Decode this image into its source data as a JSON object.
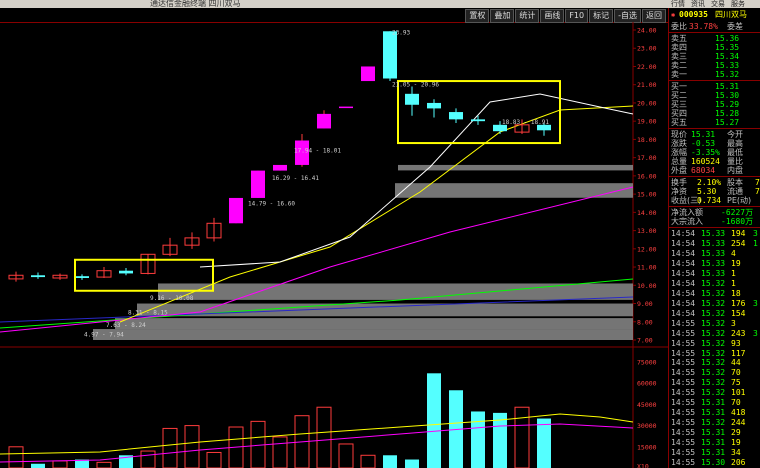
{
  "window": {
    "title": "通达信金融终端 四川双马"
  },
  "toolbar": {
    "buttons": [
      "置权",
      "叠加",
      "统计",
      "画线",
      "F10",
      "标记",
      "-自选",
      "返回"
    ]
  },
  "right_tabs": [
    "行情",
    "资讯",
    "交易",
    "服务"
  ],
  "stock": {
    "code": "000935",
    "name": "四川双马",
    "flag": "✱"
  },
  "ratio": {
    "label1": "委比",
    "value": "33.78%",
    "label2": "委差",
    "diff": ""
  },
  "asks": [
    {
      "label": "卖五",
      "price": "15.36"
    },
    {
      "label": "卖四",
      "price": "15.35"
    },
    {
      "label": "卖三",
      "price": "15.34"
    },
    {
      "label": "卖二",
      "price": "15.33"
    },
    {
      "label": "卖一",
      "price": "15.32"
    }
  ],
  "bids": [
    {
      "label": "买一",
      "price": "15.31"
    },
    {
      "label": "买二",
      "price": "15.30"
    },
    {
      "label": "买三",
      "price": "15.29"
    },
    {
      "label": "买四",
      "price": "15.28"
    },
    {
      "label": "买五",
      "price": "15.27"
    }
  ],
  "quote": [
    {
      "l1": "现价",
      "v1": "15.31",
      "l2": "今开",
      "c1": "#00ff00"
    },
    {
      "l1": "涨跌",
      "v1": "-0.53",
      "l2": "最高",
      "c1": "#00ff00"
    },
    {
      "l1": "涨幅",
      "v1": "-3.35%",
      "l2": "最低",
      "c1": "#00ff00"
    },
    {
      "l1": "总量",
      "v1": "160524",
      "l2": "量比",
      "c1": "#ffff00"
    },
    {
      "l1": "外盘",
      "v1": "68034",
      "l2": "内盘",
      "c1": "#ff4040"
    }
  ],
  "stats": [
    {
      "l1": "换手",
      "v1": "2.10%",
      "l2": "股本",
      "v2": "7"
    },
    {
      "l1": "净资",
      "v1": "5.30",
      "l2": "流通",
      "v2": "7"
    },
    {
      "l1": "收益(三)",
      "v1": "0.734",
      "l2": "PE(动)",
      "v2": ""
    }
  ],
  "flows": [
    {
      "label": "净流入额",
      "value": "-6227万"
    },
    {
      "label": "大宗流入",
      "value": "-1680万"
    }
  ],
  "ticks": [
    {
      "t": "14:54",
      "p": "15.33",
      "v": "194",
      "d": "3"
    },
    {
      "t": "14:54",
      "p": "15.33",
      "v": "254",
      "d": "1"
    },
    {
      "t": "14:54",
      "p": "15.33",
      "v": "4",
      "d": ""
    },
    {
      "t": "14:54",
      "p": "15.33",
      "v": "19",
      "d": ""
    },
    {
      "t": "14:54",
      "p": "15.33",
      "v": "1",
      "d": ""
    },
    {
      "t": "14:54",
      "p": "15.32",
      "v": "1",
      "d": ""
    },
    {
      "t": "14:54",
      "p": "15.32",
      "v": "18",
      "d": ""
    },
    {
      "t": "14:54",
      "p": "15.32",
      "v": "176",
      "d": "3"
    },
    {
      "t": "14:54",
      "p": "15.32",
      "v": "154",
      "d": ""
    },
    {
      "t": "14:55",
      "p": "15.32",
      "v": "3",
      "d": ""
    },
    {
      "t": "14:55",
      "p": "15.32",
      "v": "243",
      "d": "3"
    },
    {
      "t": "14:55",
      "p": "15.32",
      "v": "93",
      "d": ""
    },
    {
      "t": "14:55",
      "p": "15.32",
      "v": "117",
      "d": ""
    },
    {
      "t": "14:55",
      "p": "15.32",
      "v": "44",
      "d": ""
    },
    {
      "t": "14:55",
      "p": "15.32",
      "v": "70",
      "d": ""
    },
    {
      "t": "14:55",
      "p": "15.32",
      "v": "75",
      "d": ""
    },
    {
      "t": "14:55",
      "p": "15.32",
      "v": "101",
      "d": ""
    },
    {
      "t": "14:55",
      "p": "15.31",
      "v": "70",
      "d": ""
    },
    {
      "t": "14:55",
      "p": "15.31",
      "v": "418",
      "d": ""
    },
    {
      "t": "14:55",
      "p": "15.32",
      "v": "244",
      "d": ""
    },
    {
      "t": "14:55",
      "p": "15.31",
      "v": "29",
      "d": ""
    },
    {
      "t": "14:55",
      "p": "15.31",
      "v": "19",
      "d": ""
    },
    {
      "t": "14:55",
      "p": "15.31",
      "v": "34",
      "d": ""
    },
    {
      "t": "14:55",
      "p": "15.30",
      "v": "206",
      "d": ""
    }
  ],
  "chart_data": {
    "type": "candlestick",
    "price_axis": {
      "min": 7,
      "max": 24,
      "labels": [
        "24.00",
        "23.00",
        "22.00",
        "21.00",
        "20.00",
        "19.00",
        "18.00",
        "17.00",
        "16.00",
        "15.00",
        "14.00",
        "13.00",
        "12.00",
        "11.00",
        "10.00",
        "9.00",
        "8.00",
        "7.00"
      ]
    },
    "volume_axis": {
      "max": 75000,
      "labels": [
        "75000",
        "60000",
        "45000",
        "30000",
        "15000",
        "X10"
      ]
    },
    "candles": [
      {
        "o": 10.35,
        "c": 10.55,
        "h": 10.75,
        "l": 10.2
      },
      {
        "o": 10.55,
        "c": 10.45,
        "h": 10.7,
        "l": 10.35
      },
      {
        "o": 10.4,
        "c": 10.55,
        "h": 10.65,
        "l": 10.3
      },
      {
        "o": 10.5,
        "c": 10.4,
        "h": 10.6,
        "l": 10.3
      },
      {
        "o": 10.45,
        "c": 10.8,
        "h": 11.0,
        "l": 10.4
      },
      {
        "o": 10.8,
        "c": 10.65,
        "h": 10.95,
        "l": 10.55
      },
      {
        "o": 10.65,
        "c": 11.7,
        "h": 11.7,
        "l": 10.6
      },
      {
        "o": 11.7,
        "c": 12.2,
        "h": 12.6,
        "l": 11.6
      },
      {
        "o": 12.2,
        "c": 12.6,
        "h": 12.9,
        "l": 12.0
      },
      {
        "o": 12.6,
        "c": 13.4,
        "h": 13.7,
        "l": 12.4
      },
      {
        "o": 13.4,
        "c": 14.79,
        "h": 14.79,
        "l": 13.4
      },
      {
        "o": 14.79,
        "c": 16.29,
        "h": 16.29,
        "l": 14.79
      },
      {
        "o": 16.29,
        "c": 16.6,
        "h": 16.6,
        "l": 16.29
      },
      {
        "o": 16.6,
        "c": 17.94,
        "h": 18.3,
        "l": 16.5
      },
      {
        "o": 18.6,
        "c": 19.4,
        "h": 19.6,
        "l": 18.6
      },
      {
        "o": 19.8,
        "c": 19.8,
        "h": 19.8,
        "l": 19.8
      },
      {
        "o": 21.2,
        "c": 22.0,
        "h": 22.0,
        "l": 21.2
      },
      {
        "o": 23.93,
        "c": 21.34,
        "h": 23.93,
        "l": 21.2
      },
      {
        "o": 20.5,
        "c": 19.9,
        "h": 20.9,
        "l": 19.3
      },
      {
        "o": 20.0,
        "c": 19.7,
        "h": 20.2,
        "l": 19.2
      },
      {
        "o": 19.5,
        "c": 19.1,
        "h": 19.7,
        "l": 18.9
      },
      {
        "o": 19.1,
        "c": 19.0,
        "h": 19.3,
        "l": 18.8
      },
      {
        "o": 18.8,
        "c": 18.45,
        "h": 19.0,
        "l": 18.3
      },
      {
        "o": 18.4,
        "c": 18.8,
        "h": 19.1,
        "l": 18.3
      },
      {
        "o": 18.8,
        "c": 18.5,
        "h": 18.9,
        "l": 18.2
      }
    ],
    "volumes": [
      15000,
      3000,
      5000,
      6000,
      4000,
      9000,
      12000,
      28000,
      30000,
      11000,
      29000,
      33000,
      22000,
      37000,
      43000,
      17000,
      9000,
      9000,
      6000,
      67000,
      55000,
      40000,
      39000,
      43000,
      35000
    ],
    "annotations": [
      "23.93",
      "21.05 - 20.96",
      "18.83 - 18.91",
      "17.94 - 18.01",
      "16.29 - 16.41",
      "14.79 - 16.60",
      "9.16 - 10.08",
      "8.31 - 8.15",
      "7.63 - 8.24",
      "4.97 - 7.94"
    ],
    "support_bands": [
      {
        "from": 16.3,
        "to": 16.6
      },
      {
        "from": 14.8,
        "to": 15.6
      },
      {
        "from": 9.2,
        "to": 10.1
      },
      {
        "from": 8.3,
        "to": 9.0
      },
      {
        "from": 7.6,
        "to": 8.2
      },
      {
        "from": 7.0,
        "to": 7.6
      }
    ],
    "colors": {
      "up": "#ff3c3c",
      "down": "#54ffff",
      "boxes": "#ffff00",
      "ma5": "#ffffff",
      "ma10": "#ffff00",
      "ma20": "#ff00ff",
      "ma60": "#00ff00"
    }
  }
}
